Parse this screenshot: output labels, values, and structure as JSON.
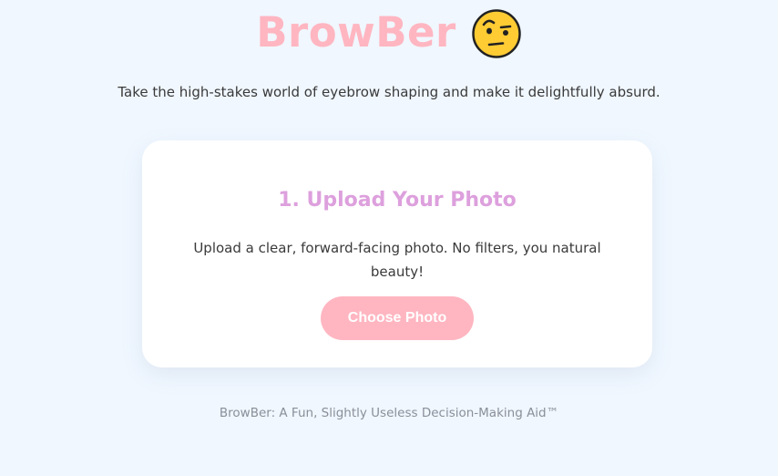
{
  "header": {
    "title": "BrowBer",
    "emoji_icon": "face-with-raised-eyebrow-icon"
  },
  "tagline": "Take the high-stakes world of eyebrow shaping and make it delightfully absurd.",
  "upload_card": {
    "title": "1. Upload Your Photo",
    "description": "Upload a clear, forward-facing photo. No filters, you natural beauty!",
    "button_label": "Choose Photo"
  },
  "footer": {
    "text": "BrowBer: A Fun, Slightly Useless Decision-Making Aid™"
  },
  "colors": {
    "background": "#f0f7ff",
    "brand_pink": "#ffb6c1",
    "card_title_plum": "#dda0dd",
    "card_background": "#ffffff",
    "footer_gray": "#8a8f98"
  }
}
